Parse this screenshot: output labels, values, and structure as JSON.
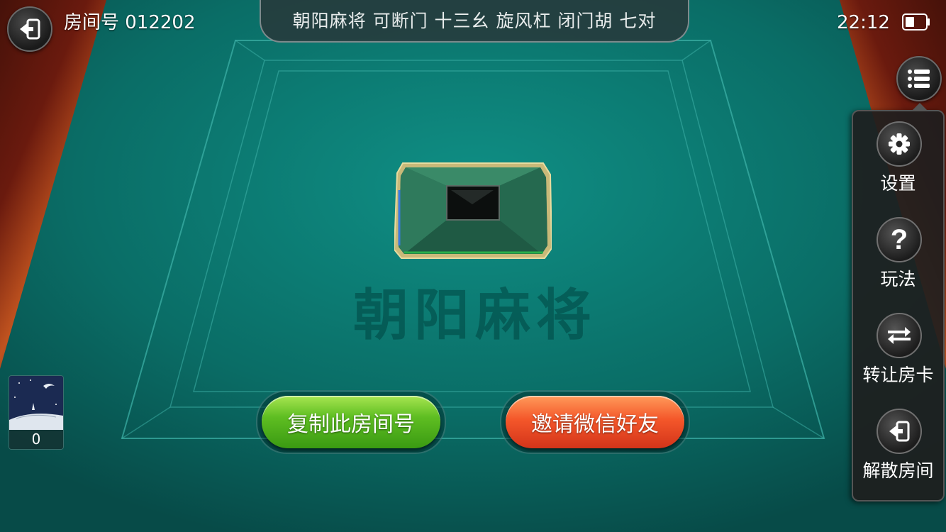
{
  "header": {
    "room_label": "房间号 012202",
    "rules": "朝阳麻将 可断门 十三幺 旋风杠 闭门胡 七对",
    "time": "22:12"
  },
  "table": {
    "watermark": "朝阳麻将"
  },
  "actions": {
    "copy_room": "复制此房间号",
    "invite_wechat": "邀请微信好友"
  },
  "side_menu": {
    "items": [
      {
        "label": "设置",
        "icon": "gear-icon"
      },
      {
        "label": "玩法",
        "icon": "question-icon"
      },
      {
        "label": "转让房卡",
        "icon": "transfer-icon"
      },
      {
        "label": "解散房间",
        "icon": "exit-icon"
      }
    ]
  },
  "player": {
    "score": "0"
  },
  "colors": {
    "felt": "#0b7169",
    "copy_button": "#5fbe22",
    "invite_button": "#f4572a",
    "menu_bg": "#1e1e1e"
  }
}
